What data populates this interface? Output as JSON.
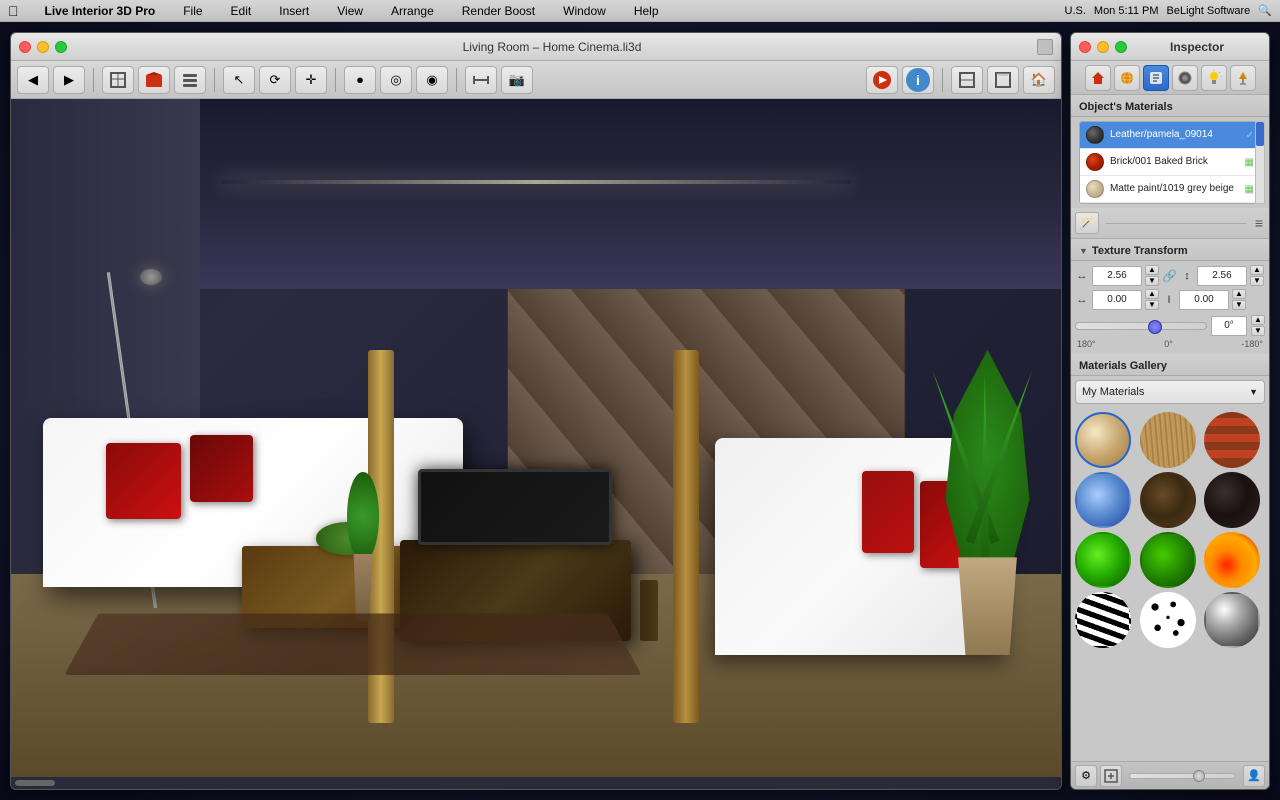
{
  "menubar": {
    "apple": "⌘",
    "app_name": "Live Interior 3D Pro",
    "menus": [
      "File",
      "Edit",
      "Insert",
      "View",
      "Arrange",
      "Render Boost",
      "Window",
      "Help"
    ],
    "right": {
      "time": "Mon 5:11 PM",
      "company": "BeLight Software",
      "locale": "U.S."
    }
  },
  "window": {
    "title": "Living Room – Home Cinema.li3d",
    "traffic_lights": [
      "close",
      "minimize",
      "maximize"
    ]
  },
  "inspector": {
    "title": "Inspector",
    "toolbar_icons": [
      "house-icon",
      "sphere-icon",
      "paint-icon",
      "material-icon",
      "light-icon",
      "lamp-icon"
    ],
    "objects_materials_label": "Object's Materials",
    "materials": [
      {
        "name": "Leather/pamela_09014",
        "type": "leather",
        "color": "#4a4a4a",
        "active": true
      },
      {
        "name": "Brick/001 Baked Brick",
        "type": "brick",
        "color": "#cc3010",
        "active": false
      },
      {
        "name": "Matte paint/1019 grey beige",
        "type": "paint",
        "color": "#d4c8a8",
        "active": false
      }
    ],
    "texture_transform": {
      "label": "Texture Transform",
      "width_val": "2.56",
      "height_val": "2.56",
      "offset_x": "0.00",
      "offset_y": "0.00",
      "rotation_val": "0°",
      "rotation_min": "180°",
      "rotation_zero": "0°",
      "rotation_max": "-180°"
    },
    "gallery": {
      "label": "Materials Gallery",
      "dropdown_value": "My Materials",
      "swatches": [
        {
          "id": "beige",
          "class": "swatch-beige",
          "label": "Beige fabric"
        },
        {
          "id": "wood-light",
          "class": "swatch-wood-light",
          "label": "Light wood"
        },
        {
          "id": "brick",
          "class": "swatch-brick",
          "label": "Brick"
        },
        {
          "id": "water",
          "class": "swatch-water",
          "label": "Water"
        },
        {
          "id": "dark-wood",
          "class": "swatch-dark-wood",
          "label": "Dark wood"
        },
        {
          "id": "very-dark",
          "class": "swatch-very-dark",
          "label": "Very dark"
        },
        {
          "id": "green-bright",
          "class": "swatch-green-bright",
          "label": "Bright green"
        },
        {
          "id": "green-mid",
          "class": "swatch-green-mid",
          "label": "Mid green"
        },
        {
          "id": "fire",
          "class": "swatch-fire",
          "label": "Fire"
        },
        {
          "id": "zebra",
          "class": "swatch-zebra",
          "label": "Zebra"
        },
        {
          "id": "spots",
          "class": "swatch-spots",
          "label": "Spots"
        },
        {
          "id": "chrome",
          "class": "swatch-chrome",
          "label": "Chrome"
        }
      ]
    },
    "bottom": {
      "gear_icon": "⚙",
      "person_icon": "👤"
    }
  }
}
